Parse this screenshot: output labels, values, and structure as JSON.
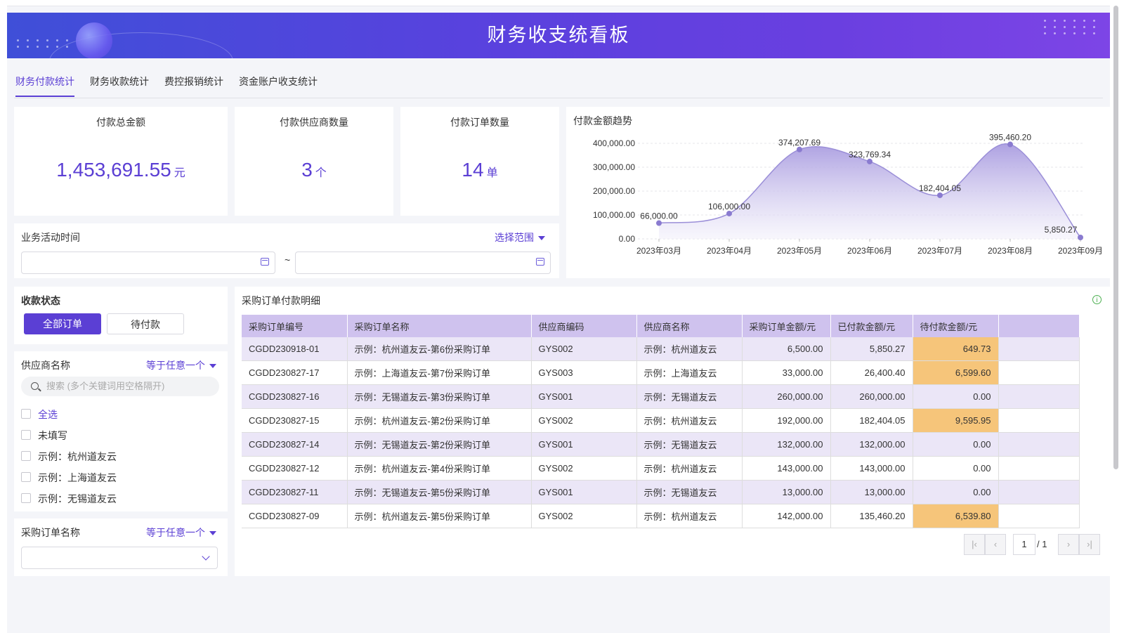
{
  "banner": {
    "title": "财务收支统看板"
  },
  "tabs": [
    "财务付款统计",
    "财务收款统计",
    "费控报销统计",
    "资金账户收支统计"
  ],
  "kpis": [
    {
      "label": "付款总金额",
      "value": "1,453,691.55",
      "unit": "元"
    },
    {
      "label": "付款供应商数量",
      "value": "3",
      "unit": "个"
    },
    {
      "label": "付款订单数量",
      "value": "14",
      "unit": "单"
    }
  ],
  "date_filter": {
    "label": "业务活动时间",
    "range_link": "选择范围",
    "separator": "~"
  },
  "chart_data": {
    "type": "area",
    "title": "付款金额趋势",
    "categories": [
      "2023年03月",
      "2023年04月",
      "2023年05月",
      "2023年06月",
      "2023年07月",
      "2023年08月",
      "2023年09月"
    ],
    "values": [
      66000.0,
      106000.0,
      374207.69,
      323769.34,
      182404.05,
      395460.2,
      5850.27
    ],
    "data_labels": [
      "66,000.00",
      "106,000.00",
      "374,207.69",
      "323,769.34",
      "182,404.05",
      "395,460.20",
      "5,850.27"
    ],
    "y_ticks": [
      "0.00",
      "100,000.00",
      "200,000.00",
      "300,000.00",
      "400,000.00"
    ],
    "ylim": [
      0,
      400000
    ],
    "grid": true,
    "colors": {
      "line": "#9b8fd8",
      "area_top": "#a99ce0",
      "area_bottom": "#f3f1fb",
      "point": "#8a7bd0"
    }
  },
  "status_filter": {
    "label": "收款状态",
    "buttons": [
      "全部订单",
      "待付款"
    ]
  },
  "supplier_filter": {
    "label": "供应商名称",
    "mode": "等于任意一个",
    "search_placeholder": "搜索 (多个关键词用空格隔开)",
    "options": [
      "全选",
      "未填写",
      "示例：杭州道友云",
      "示例：上海道友云",
      "示例：无锡道友云"
    ]
  },
  "order_name_filter": {
    "label": "采购订单名称",
    "mode": "等于任意一个"
  },
  "table": {
    "title": "采购订单付款明细",
    "columns": [
      "采购订单编号",
      "采购订单名称",
      "供应商编码",
      "供应商名称",
      "采购订单金额/元",
      "已付款金额/元",
      "待付款金额/元"
    ],
    "rows": [
      [
        "CGDD230918-01",
        "示例：杭州道友云-第6份采购订单",
        "GYS002",
        "示例：杭州道友云",
        "6,500.00",
        "5,850.27",
        "649.73"
      ],
      [
        "CGDD230827-17",
        "示例：上海道友云-第7份采购订单",
        "GYS003",
        "示例：上海道友云",
        "33,000.00",
        "26,400.40",
        "6,599.60"
      ],
      [
        "CGDD230827-16",
        "示例：无锡道友云-第3份采购订单",
        "GYS001",
        "示例：无锡道友云",
        "260,000.00",
        "260,000.00",
        "0.00"
      ],
      [
        "CGDD230827-15",
        "示例：杭州道友云-第2份采购订单",
        "GYS002",
        "示例：杭州道友云",
        "192,000.00",
        "182,404.05",
        "9,595.95"
      ],
      [
        "CGDD230827-14",
        "示例：无锡道友云-第2份采购订单",
        "GYS001",
        "示例：无锡道友云",
        "132,000.00",
        "132,000.00",
        "0.00"
      ],
      [
        "CGDD230827-12",
        "示例：杭州道友云-第4份采购订单",
        "GYS002",
        "示例：杭州道友云",
        "143,000.00",
        "143,000.00",
        "0.00"
      ],
      [
        "CGDD230827-11",
        "示例：无锡道友云-第5份采购订单",
        "GYS001",
        "示例：无锡道友云",
        "13,000.00",
        "13,000.00",
        "0.00"
      ],
      [
        "CGDD230827-09",
        "示例：杭州道友云-第5份采购订单",
        "GYS002",
        "示例：杭州道友云",
        "142,000.00",
        "135,460.20",
        "6,539.80"
      ]
    ],
    "highlight_color": "#f6c57a"
  },
  "pagination": {
    "current": "1",
    "total": "/ 1"
  }
}
